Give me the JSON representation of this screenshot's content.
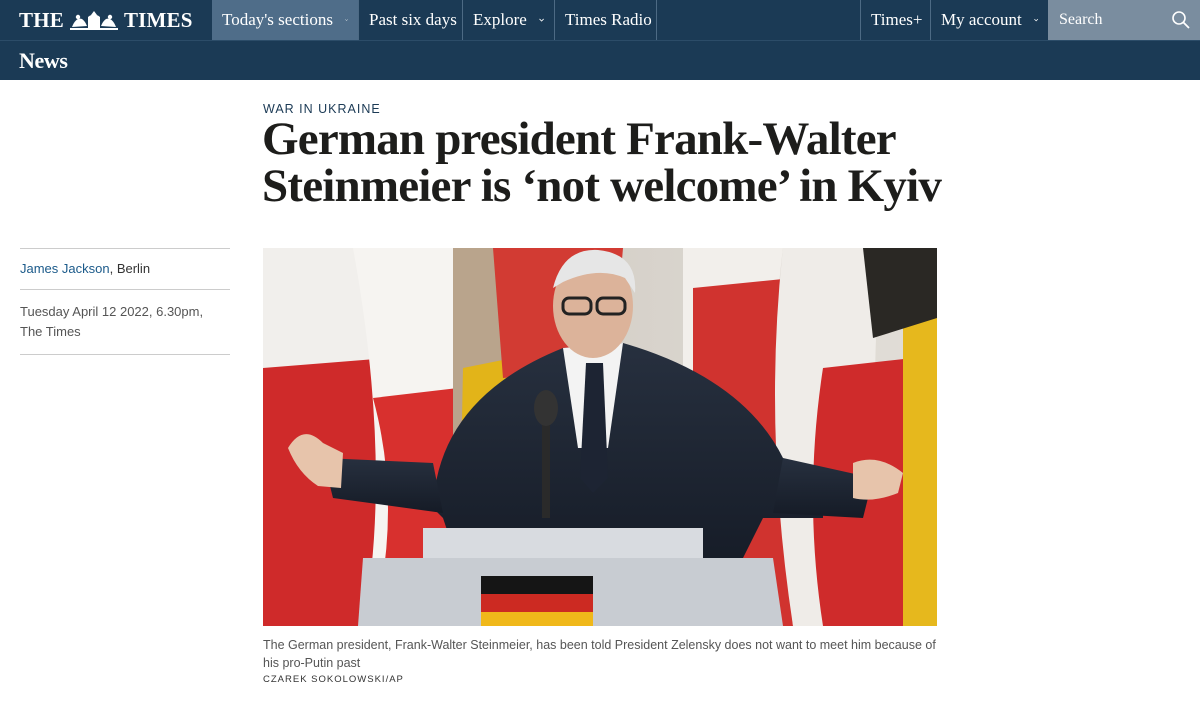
{
  "masthead": {
    "logo_left": "THE",
    "logo_right": "TIMES",
    "nav": {
      "sections_label": "Today's sections",
      "past_label": "Past six days",
      "explore_label": "Explore",
      "radio_label": "Times Radio",
      "timesplus_label": "Times+",
      "account_label": "My account"
    },
    "search": {
      "placeholder": "Search"
    }
  },
  "section": {
    "title": "News"
  },
  "article": {
    "kicker": "WAR IN UKRAINE",
    "headline": "German president Frank-Walter Steinmeier is ‘not welcome’ in Kyiv",
    "author": "James Jackson",
    "location": ", Berlin",
    "date": "Tuesday April 12 2022, 6.30pm,",
    "publication": "The Times",
    "caption": "The German president, Frank-Walter Steinmeier, has been told President Zelensky does not want to meet him because of his pro-Putin past",
    "credit": "CZAREK SOKOLOWSKI/AP"
  },
  "colors": {
    "masthead_bg": "#1b3a55",
    "active_nav_bg": "#4f6d89",
    "search_bg": "#7a8d9f",
    "link": "#1b5a8a"
  },
  "icons": {
    "logo_crest": "royal-crest-icon",
    "dropdown": "chevron-down-icon",
    "search": "magnifier-icon"
  }
}
